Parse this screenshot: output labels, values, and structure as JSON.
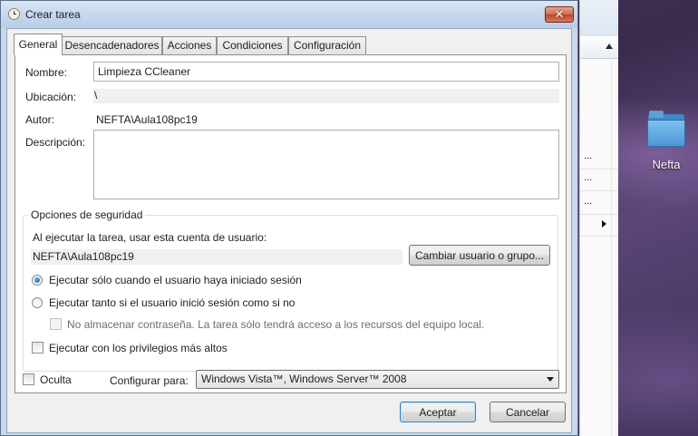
{
  "dialog": {
    "title": "Crear tarea",
    "close_symbol": "✕"
  },
  "tabs": [
    {
      "label": "General",
      "active": true
    },
    {
      "label": "Desencadenadores",
      "active": false
    },
    {
      "label": "Acciones",
      "active": false
    },
    {
      "label": "Condiciones",
      "active": false
    },
    {
      "label": "Configuración",
      "active": false
    }
  ],
  "general": {
    "name_label": "Nombre:",
    "name_value": "Limpieza CCleaner",
    "location_label": "Ubicación:",
    "location_value": "\\",
    "author_label": "Autor:",
    "author_value": "NEFTA\\Aula108pc19",
    "description_label": "Descripción:",
    "description_value": ""
  },
  "security": {
    "legend": "Opciones de seguridad",
    "account_prompt": "Al ejecutar la tarea, usar esta cuenta de usuario:",
    "account_value": "NEFTA\\Aula108pc19",
    "change_user_button": "Cambiar usuario o grupo...",
    "radio_logged_on": {
      "label": "Ejecutar sólo cuando el usuario haya iniciado sesión",
      "checked": true
    },
    "radio_whether": {
      "label": "Ejecutar tanto si el usuario inició sesión como si no",
      "checked": false
    },
    "no_store_password": {
      "label": "No almacenar contraseña. La tarea sólo tendrá acceso a los recursos del equipo local.",
      "checked": false,
      "enabled": false
    },
    "highest_privileges": {
      "label": "Ejecutar con los privilegios más altos",
      "checked": false
    }
  },
  "footer_options": {
    "hidden_label": "Oculta",
    "hidden_checked": false,
    "configure_for_label": "Configurar para:",
    "configure_for_value": "Windows Vista™, Windows Server™ 2008"
  },
  "buttons": {
    "ok": "Aceptar",
    "cancel": "Cancelar"
  },
  "desktop": {
    "folder_label": "Nefta"
  },
  "background_window": {
    "row_markers": [
      "...",
      "...",
      "..."
    ]
  },
  "colors": {
    "title_bar": "#c6d8ee",
    "close_button": "#c04529",
    "default_button_border": "#3c7fb1"
  }
}
